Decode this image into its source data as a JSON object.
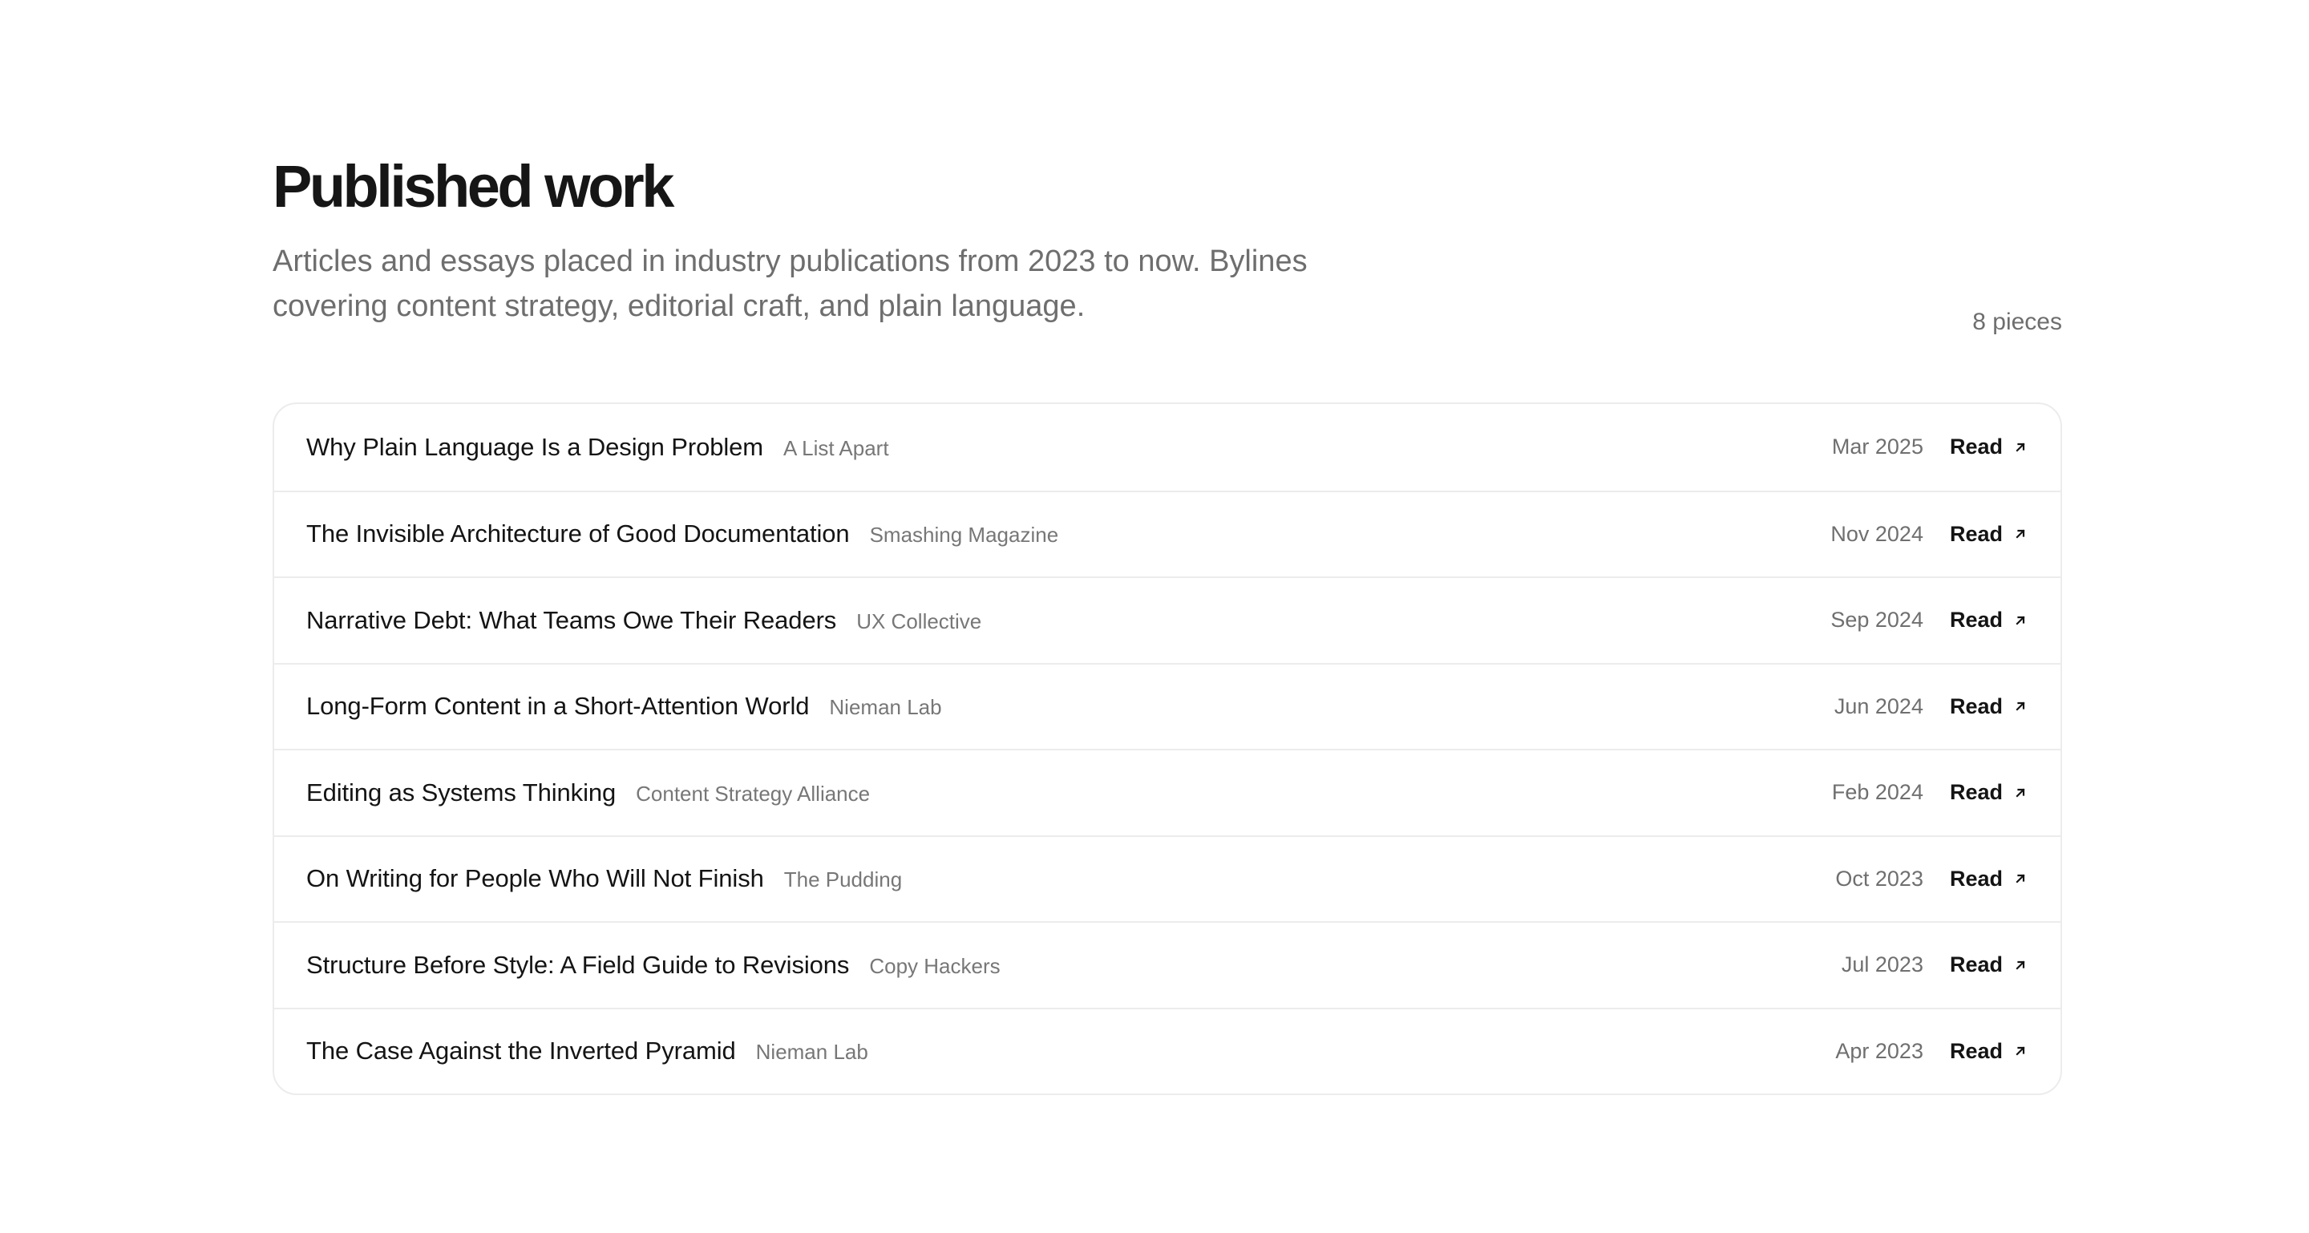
{
  "header": {
    "title": "Published work",
    "subtitle": "Articles and essays placed in industry publications from 2023 to now. Bylines covering content strategy, editorial craft, and plain language.",
    "count": "8 pieces"
  },
  "read_label": "Read",
  "icons": {
    "read": "arrow-up-right-icon"
  },
  "articles": [
    {
      "title": "Why Plain Language Is a Design Problem",
      "publication": "A List Apart",
      "date": "Mar 2025"
    },
    {
      "title": "The Invisible Architecture of Good Documentation",
      "publication": "Smashing Magazine",
      "date": "Nov 2024"
    },
    {
      "title": "Narrative Debt: What Teams Owe Their Readers",
      "publication": "UX Collective",
      "date": "Sep 2024"
    },
    {
      "title": "Long-Form Content in a Short-Attention World",
      "publication": "Nieman Lab",
      "date": "Jun 2024"
    },
    {
      "title": "Editing as Systems Thinking",
      "publication": "Content Strategy Alliance",
      "date": "Feb 2024"
    },
    {
      "title": "On Writing for People Who Will Not Finish",
      "publication": "The Pudding",
      "date": "Oct 2023"
    },
    {
      "title": "Structure Before Style: A Field Guide to Revisions",
      "publication": "Copy Hackers",
      "date": "Jul 2023"
    },
    {
      "title": "The Case Against the Inverted Pyramid",
      "publication": "Nieman Lab",
      "date": "Apr 2023"
    }
  ]
}
